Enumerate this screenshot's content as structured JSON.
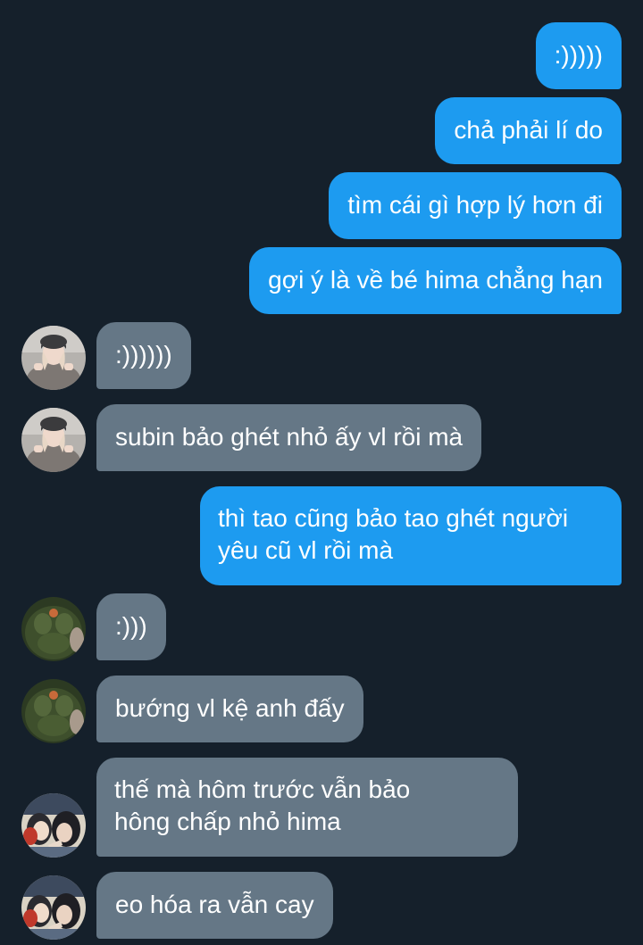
{
  "colors": {
    "background": "#15202b",
    "sent_bubble": "#1d9bf0",
    "received_bubble": "#657786",
    "text": "#ffffff"
  },
  "messages": [
    {
      "direction": "sent",
      "text": ":)))))"
    },
    {
      "direction": "sent",
      "text": "chả phải lí do"
    },
    {
      "direction": "sent",
      "text": "tìm cái gì hợp lý hơn đi"
    },
    {
      "direction": "sent",
      "text": "gợi ý là về bé hima chẳng hạn"
    },
    {
      "direction": "received",
      "avatar": "girl-beanie-avatar",
      "text": ":))))))"
    },
    {
      "direction": "received",
      "avatar": "girl-beanie-avatar",
      "text": "subin bảo ghét nhỏ ấy vl rồi mà"
    },
    {
      "direction": "sent",
      "lines": [
        "thì tao cũng bảo tao ghét người",
        "yêu cũ vl rồi mà"
      ]
    },
    {
      "direction": "received",
      "avatar": "green-creature-avatar",
      "text": ":)))"
    },
    {
      "direction": "received",
      "avatar": "green-creature-avatar",
      "text": "bướng vl kệ anh đấy"
    },
    {
      "direction": "received",
      "avatar": "anime-characters-avatar",
      "lines": [
        "thế mà hôm trước vẫn bảo",
        "hông chấp nhỏ hima"
      ]
    },
    {
      "direction": "received",
      "avatar": "anime-characters-avatar",
      "text": "eo hóa ra vẫn cay"
    }
  ]
}
